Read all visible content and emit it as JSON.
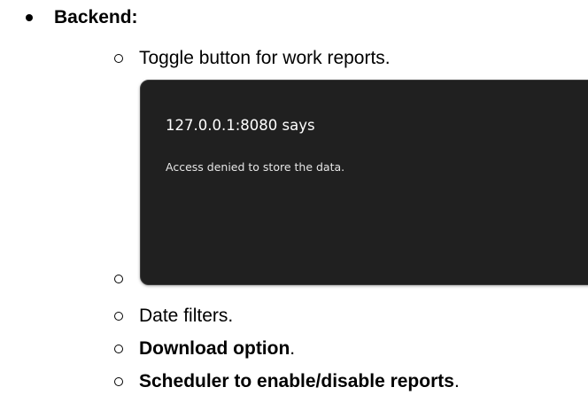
{
  "section": {
    "heading": "Backend:"
  },
  "items": [
    {
      "text": "Toggle button for work reports."
    },
    {
      "text": ""
    },
    {
      "text": "Date filters."
    },
    {
      "bold_text": "Download option",
      "suffix": "."
    },
    {
      "bold_text": "Scheduler to enable/disable reports",
      "suffix": "."
    }
  ],
  "dialog": {
    "title": "127.0.0.1:8080 says",
    "message": "Access denied to store the data."
  }
}
